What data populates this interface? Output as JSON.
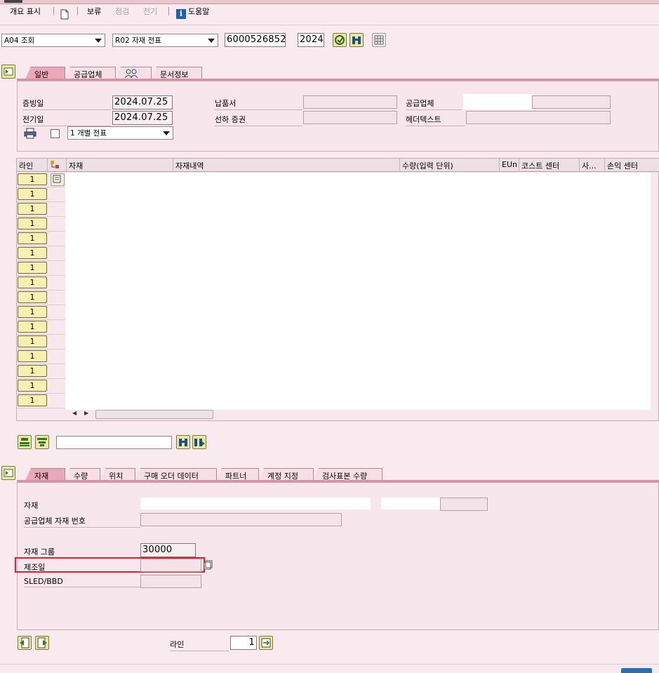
{
  "toolbar": {
    "overview": "개요 표시",
    "hold": "보류",
    "check": "점검",
    "post": "전기",
    "help": "도움말"
  },
  "header": {
    "action_select": "A04 조회",
    "doc_type_select": "R02 자재 전표",
    "doc_number": "6000526852",
    "year": "2024"
  },
  "header_tabs": [
    "일반",
    "공급업체",
    "",
    "문서정보"
  ],
  "general": {
    "doc_date_label": "증빙일",
    "doc_date": "2024.07.25",
    "posting_date_label": "전기일",
    "posting_date": "2024.07.25",
    "delivery_note_label": "납품서",
    "bill_of_lading_label": "선하 증권",
    "vendor_label": "공급업체",
    "header_text_label": "헤더텍스트",
    "print_select": "1 개별 전표"
  },
  "table": {
    "columns": [
      "라인",
      "",
      "자재",
      "자재내역",
      "수량(입력 단위)",
      "EUn",
      "코스트 센터",
      "사...",
      "손익 센터"
    ],
    "rows": [
      "1",
      "1",
      "1",
      "1",
      "1",
      "1",
      "1",
      "1",
      "1",
      "1",
      "1",
      "1",
      "1",
      "1",
      "1",
      "1"
    ]
  },
  "detail_tabs": [
    "자재",
    "수량",
    "위치",
    "구매 오더 데이터",
    "파트너",
    "계정 지정",
    "검사표본 수량"
  ],
  "detail": {
    "material_label": "자재",
    "vendor_material_label": "공급업체 자재 번호",
    "material_group_label": "자재 그룹",
    "material_group": "30000",
    "mfg_date_label": "제조일",
    "sled_label": "SLED/BBD"
  },
  "footer": {
    "line_label": "라인",
    "line_value": "1"
  },
  "colors": {
    "accent_tab": "#e9a9bb",
    "highlight": "#e0242a",
    "button": "#efe7a1"
  }
}
